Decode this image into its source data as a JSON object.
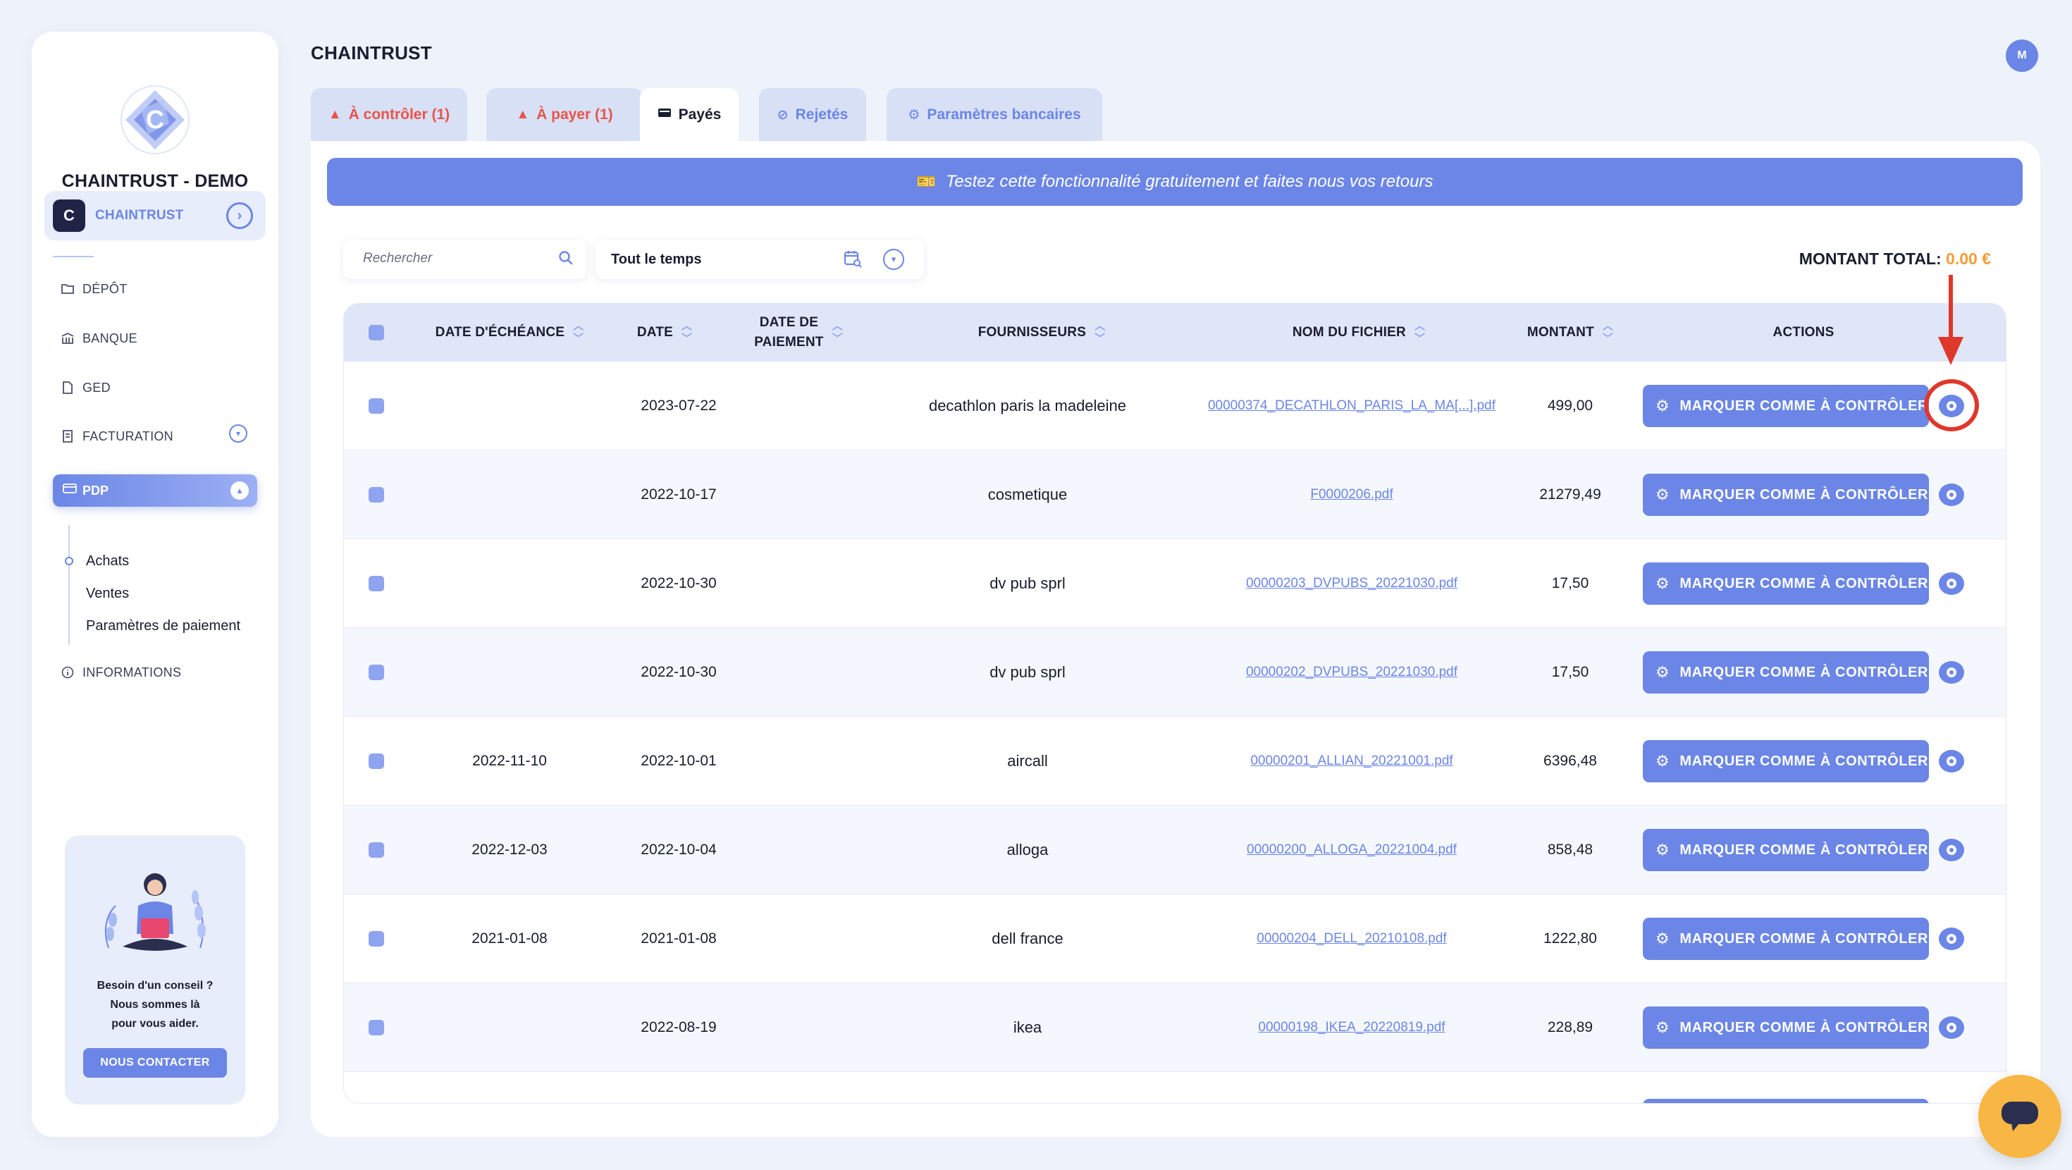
{
  "sidebar": {
    "org_name": "CHAINTRUST - DEMO",
    "workspace_label": "CHAINTRUST",
    "nav": [
      {
        "label": "DÉPÔT",
        "icon": "folder-icon"
      },
      {
        "label": "BANQUE",
        "icon": "bank-icon"
      },
      {
        "label": "GED",
        "icon": "document-icon"
      },
      {
        "label": "FACTURATION",
        "icon": "invoice-icon"
      },
      {
        "label": "PDP",
        "icon": "card-icon"
      },
      {
        "label": "INFORMATIONS",
        "icon": "info-icon"
      }
    ],
    "pdp_sub": [
      "Achats",
      "Ventes",
      "Paramètres de paiement"
    ],
    "help": {
      "line1": "Besoin d'un conseil ?",
      "line2": "Nous sommes là",
      "line3": "pour vous aider.",
      "button": "NOUS CONTACTER"
    }
  },
  "header": {
    "title": "CHAINTRUST",
    "avatar_initial": "M"
  },
  "tabs": [
    {
      "label": "À contrôler (1)",
      "icon": "warning-icon",
      "color": "#e8544b"
    },
    {
      "label": "À payer (1)",
      "icon": "warning-icon",
      "color": "#e8544b"
    },
    {
      "label": "Payés",
      "icon": "wallet-icon",
      "color": "#1a1d2e"
    },
    {
      "label": "Rejetés",
      "icon": "ban-icon",
      "color": "#6b86e6"
    },
    {
      "label": "Paramètres bancaires",
      "icon": "gear-icon",
      "color": "#6b86e6"
    }
  ],
  "banner": {
    "text": "Testez cette fonctionnalité gratuitement et faites nous vos retours"
  },
  "filters": {
    "search_placeholder": "Rechercher",
    "period": "Tout le temps"
  },
  "total": {
    "label": "MONTANT TOTAL:",
    "value": "0.00 €"
  },
  "table": {
    "headers": {
      "due_date": "DATE D'ÉCHÉANCE",
      "date": "DATE",
      "payment_date_l1": "DATE DE",
      "payment_date_l2": "PAIEMENT",
      "supplier": "FOURNISSEURS",
      "file": "NOM DU FICHIER",
      "amount": "MONTANT",
      "actions": "ACTIONS"
    },
    "action_label": "MARQUER COMME À CONTRÔLER",
    "rows": [
      {
        "due": "",
        "date": "2023-07-22",
        "supplier": "decathlon paris la madeleine",
        "file": "00000374_DECATHLON_PARIS_LA_MA[...].pdf",
        "amount": "499,00"
      },
      {
        "due": "",
        "date": "2022-10-17",
        "supplier": "cosmetique",
        "file": "F0000206.pdf",
        "amount": "21279,49"
      },
      {
        "due": "",
        "date": "2022-10-30",
        "supplier": "dv pub sprl",
        "file": "00000203_DVPUBS_20221030.pdf",
        "amount": "17,50"
      },
      {
        "due": "",
        "date": "2022-10-30",
        "supplier": "dv pub sprl",
        "file": "00000202_DVPUBS_20221030.pdf",
        "amount": "17,50"
      },
      {
        "due": "2022-11-10",
        "date": "2022-10-01",
        "supplier": "aircall",
        "file": "00000201_ALLIAN_20221001.pdf",
        "amount": "6396,48"
      },
      {
        "due": "2022-12-03",
        "date": "2022-10-04",
        "supplier": "alloga",
        "file": "00000200_ALLOGA_20221004.pdf",
        "amount": "858,48"
      },
      {
        "due": "2021-01-08",
        "date": "2021-01-08",
        "supplier": "dell france",
        "file": "00000204_DELL_20210108.pdf",
        "amount": "1222,80"
      },
      {
        "due": "",
        "date": "2022-08-19",
        "supplier": "ikea",
        "file": "00000198_IKEA_20220819.pdf",
        "amount": "228,89"
      }
    ]
  },
  "colors": {
    "accent": "#6b86e6",
    "warning": "#e8544b",
    "total_amount": "#f29d38",
    "annotation": "#e0372b",
    "chat": "#f8b744"
  }
}
